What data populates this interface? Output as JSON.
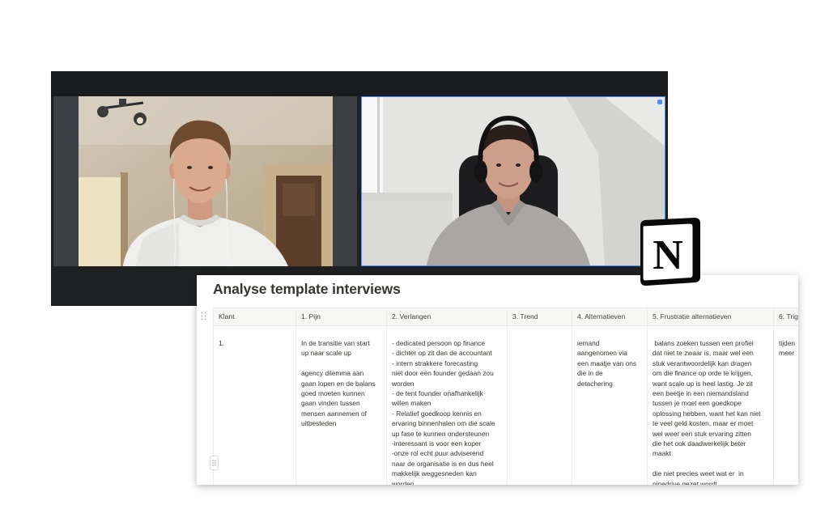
{
  "video_call": {
    "window_color": "#1f2022",
    "active_speaker_border": "#4a8cff",
    "tiles": [
      {
        "position": "left",
        "icon": "video-feed"
      },
      {
        "position": "right",
        "icon": "video-feed",
        "active_speaker": true
      }
    ]
  },
  "notion_logo": {
    "letter": "N"
  },
  "notion_page": {
    "title": "Analyse template interviews",
    "text_color": "#37352f",
    "header_bg": "#f7f7f5",
    "drag_icon": "drag-handle-icon",
    "columns": [
      {
        "key": "klant",
        "label": "Klant"
      },
      {
        "key": "pijn",
        "label": "1. Pijn"
      },
      {
        "key": "verlangen",
        "label": "2. Verlangen"
      },
      {
        "key": "trend",
        "label": "3. Trend"
      },
      {
        "key": "alternatieven",
        "label": "4. Alternatieven"
      },
      {
        "key": "frustratie",
        "label": "5. Frustratie alternatieven"
      },
      {
        "key": "trig",
        "label": "6. Trig"
      }
    ],
    "rows": [
      {
        "klant": "1.",
        "pijn": "In de transitie van start\nup naar scale up\n\nagency dilemma aan\ngaan lopen en de balans\ngoed moeten kunnen\ngaan vinden tussen\nmensen aannemen of\nuitbesteden",
        "verlangen": "- dedicated persoon op finance\n- dichter op zit dan de accountant\n- intern strakkere forecasting\nniet door een founder gedaan zou\nworden\n- de tent founder onafhankelijk\nwillen maken\n- Relatief goedkoop kennis en\nervaring binnenhalen om die scale\nup fase te kunnen ondersteunen\n-interessant is voor een koper\n-onze rol echt puur adviserend\nnaar de organisatie is en dus heel\nmakkelijk weggesneden kan\nworden",
        "trend": "",
        "alternatieven": "iemand\naangenomen via\neen maatje van ons\ndie in de\ndetachering",
        "frustratie": " balans zoeken tussen een profiel\ndat niet te zwaar is, maar wel een\nstuk verantwoordelijk kan dragen\nom die finance op orde te krijgen,\nwant scale up is heel lastig. Je zit\neen beetje in een niemandsland\ntussen je moet een goedkope\noplossing hebben, want het kan niet\nte veel geld kosten, maar er moet\nwel weer een stuk ervaring zitten\ndie het ook daadwerkelijk beter\nmaakt\n\ndie niet precies weet wat er  in\npipedrive gezet wordt",
        "trig": "tijden\nmeer"
      }
    ]
  }
}
